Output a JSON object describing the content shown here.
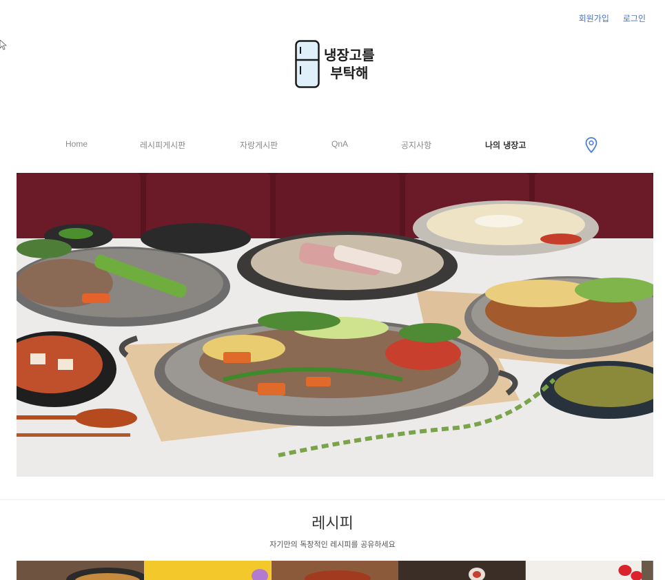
{
  "header": {
    "signup_label": "회원가입",
    "login_label": "로그인"
  },
  "logo": {
    "line1": "냉장고를",
    "line2": "부탁해"
  },
  "nav": {
    "items": [
      "Home",
      "레시피게시판",
      "자랑게시판",
      "QnA",
      "공지사항",
      "나의 냉장고"
    ],
    "location_icon": "map-pin-icon"
  },
  "hero": {
    "image": "korean-table-spread-photo"
  },
  "recipe_section": {
    "title": "레시피",
    "subtitle": "자기만의 독창적인 레시피를 공유하세요"
  },
  "colors": {
    "link": "#4a72c4",
    "nav_muted": "#8a8a8a",
    "fridge": "#dff0fb"
  }
}
